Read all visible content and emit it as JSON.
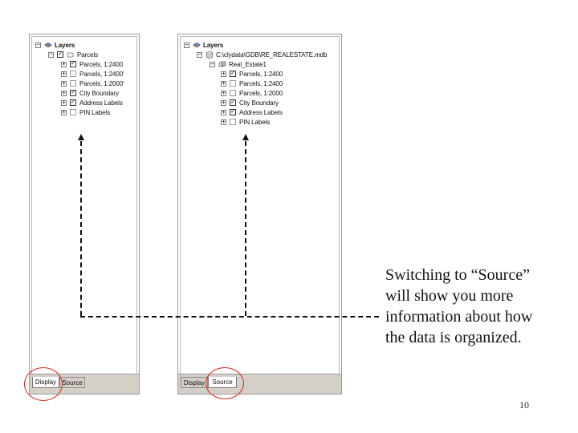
{
  "left_panel": {
    "root_label": "Layers",
    "rows": [
      {
        "label": "Parcels",
        "expander": "⊟",
        "checked": true,
        "icon": "group-layer-icon"
      },
      {
        "label": "Parcels, 1:2400",
        "expander": "⊞",
        "checked": true
      },
      {
        "label": "Parcels, 1:2400'",
        "expander": "⊞",
        "checked": false
      },
      {
        "label": "Parcels, 1:2000'",
        "expander": "⊞",
        "checked": false
      },
      {
        "label": "City Boundary",
        "expander": "⊞",
        "checked": true
      },
      {
        "label": "Address Labels",
        "expander": "⊞",
        "checked": true
      },
      {
        "label": "PIN Labels",
        "expander": "⊞",
        "checked": false
      }
    ],
    "tabs": [
      {
        "label": "Display",
        "active": true
      },
      {
        "label": "Source",
        "active": false
      }
    ]
  },
  "right_panel": {
    "root_label": "Layers",
    "rows": [
      {
        "label": "C:\\clydata\\GDB\\RE_REALESTATE.mdb",
        "expander": "⊟",
        "icon": "database-icon"
      },
      {
        "label": "Real_Estate1",
        "expander": "⊟",
        "icon": "feature-dataset-icon"
      },
      {
        "label": "Parcels, 1:2400",
        "expander": "⊞",
        "checked": true
      },
      {
        "label": "Parcels, 1:2400",
        "expander": "⊞",
        "checked": false
      },
      {
        "label": "Parcels, 1:2000",
        "expander": "⊞",
        "checked": false
      },
      {
        "label": "City Boundary",
        "expander": "⊞",
        "checked": true
      },
      {
        "label": "Address Labels",
        "expander": "⊞",
        "checked": true
      },
      {
        "label": "PIN Labels",
        "expander": "⊞",
        "checked": false
      }
    ],
    "tabs": [
      {
        "label": "Display",
        "active": false
      },
      {
        "label": "Source",
        "active": true
      }
    ]
  },
  "callout": {
    "lines": [
      "Switching to “Source”",
      "will show you more",
      "information about how",
      "the data is organized."
    ]
  },
  "page_number": "10",
  "colors": {
    "circle": "#e0201c",
    "dashes": "#111111",
    "tab_bar": "#d4d0c8"
  }
}
